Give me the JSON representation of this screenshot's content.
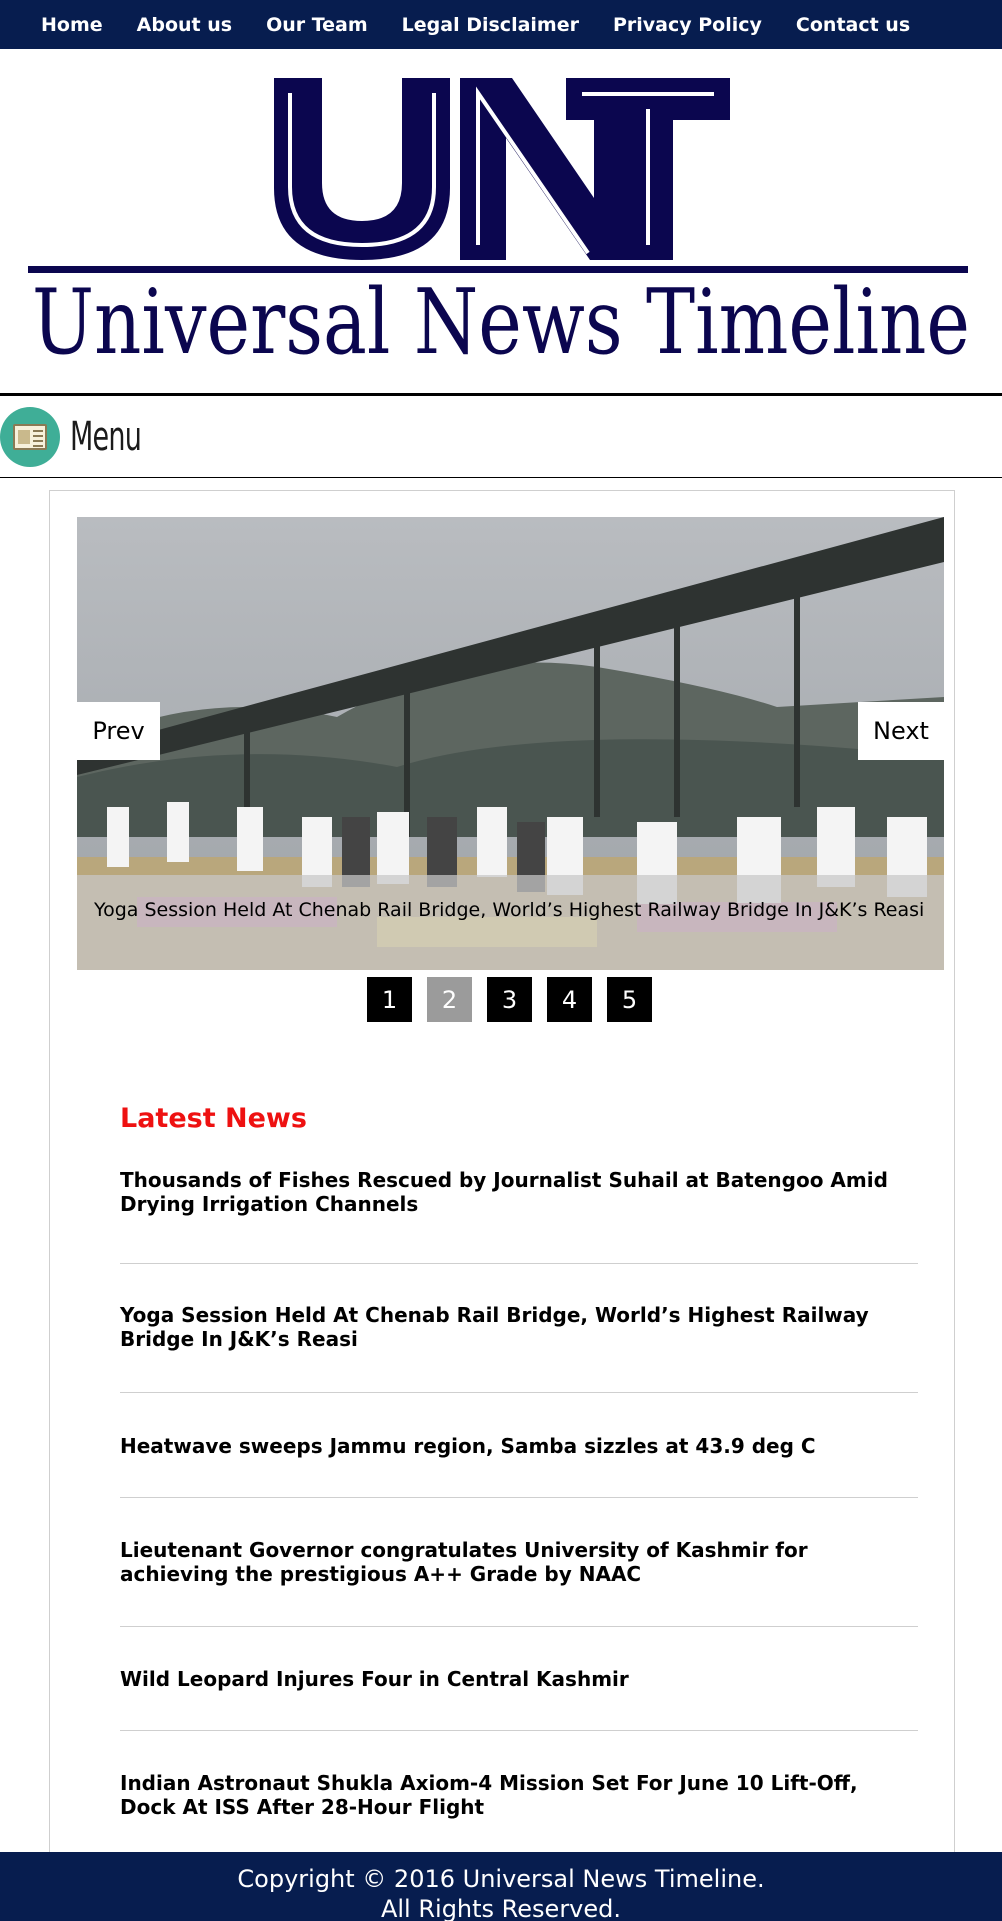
{
  "nav": {
    "items": [
      "Home",
      "About us",
      "Our Team",
      "Legal Disclaimer",
      "Privacy Policy",
      "Contact us"
    ]
  },
  "logo": {
    "letters": "UNT",
    "tagline": "Universal News Timeline",
    "color": "#0b064f"
  },
  "menu": {
    "label": "Menu"
  },
  "slider": {
    "prev_label": "Prev",
    "next_label": "Next",
    "caption": "Yoga Session Held At Chenab Rail Bridge, World’s Highest Railway Bridge In J&K’s Reasi",
    "pages": [
      "1",
      "2",
      "3",
      "4",
      "5"
    ],
    "active_page": "2"
  },
  "latest": {
    "title": "Latest News",
    "title_color": "#ee1111",
    "items": [
      "Thousands of Fishes Rescued by Journalist Suhail at Batengoo Amid Drying Irrigation Channels",
      "Yoga Session Held At Chenab Rail Bridge, World’s Highest Railway Bridge In J&K’s Reasi",
      "Heatwave sweeps Jammu region, Samba sizzles at 43.9 deg C",
      "Lieutenant Governor congratulates University of Kashmir for achieving the prestigious A++ Grade by NAAC",
      "Wild Leopard Injures Four in Central Kashmir",
      "Indian Astronaut Shukla Axiom-4 Mission Set For June 10 Lift-Off, Dock At ISS After 28-Hour Flight"
    ]
  },
  "footer": {
    "line1": "Copyright © 2016 Universal News Timeline.",
    "line2": "All Rights Reserved."
  },
  "colors": {
    "nav_bg": "#071d4f",
    "accent": "#ee1111"
  }
}
